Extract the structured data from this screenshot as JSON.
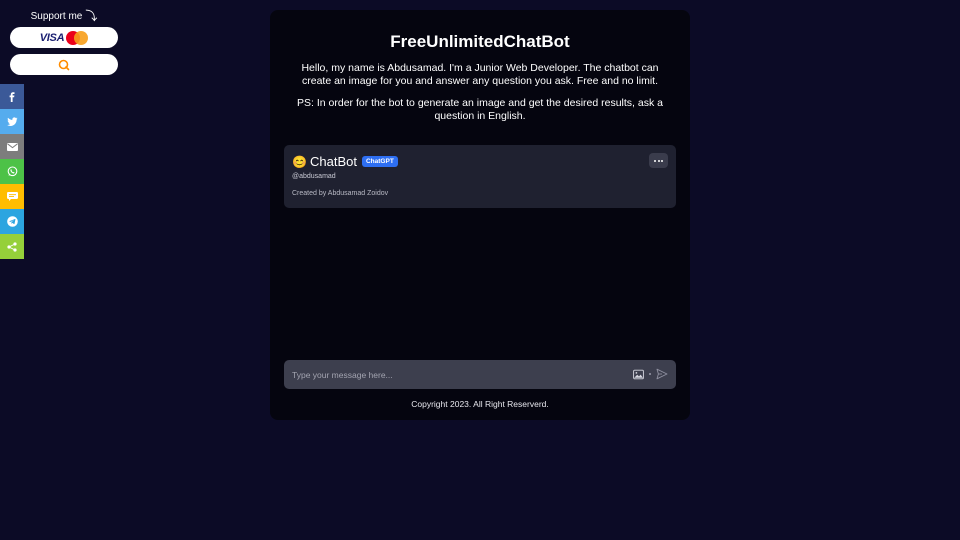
{
  "support": {
    "label": "Support me",
    "visa_text": "VISA"
  },
  "share": {
    "icons": [
      "facebook-icon",
      "twitter-icon",
      "email-icon",
      "whatsapp-icon",
      "sms-icon",
      "telegram-icon",
      "share-icon"
    ]
  },
  "main": {
    "title": "FreeUnlimitedChatBot",
    "intro": "Hello, my name is Abdusamad. I'm a Junior Web Developer. The chatbot can create an image for you and answer any question you ask. Free and no limit.",
    "ps": "PS: In order for the bot to generate an image and get the desired results, ask a question in English."
  },
  "bot": {
    "emoji": "😊",
    "name": "ChatBot",
    "badge": "ChatGPT",
    "handle": "@abdusamad",
    "created_by": "Created by Abdusamad Zoidov"
  },
  "chat": {
    "placeholder": "Type your message here..."
  },
  "footer": {
    "copyright": "Copyright 2023. All Right Reserverd."
  },
  "colors": {
    "background": "#0c0b26",
    "card": "#05050f",
    "bot_card": "#1f2130",
    "input": "#3d3f4e",
    "badge": "#2e6ff2"
  }
}
